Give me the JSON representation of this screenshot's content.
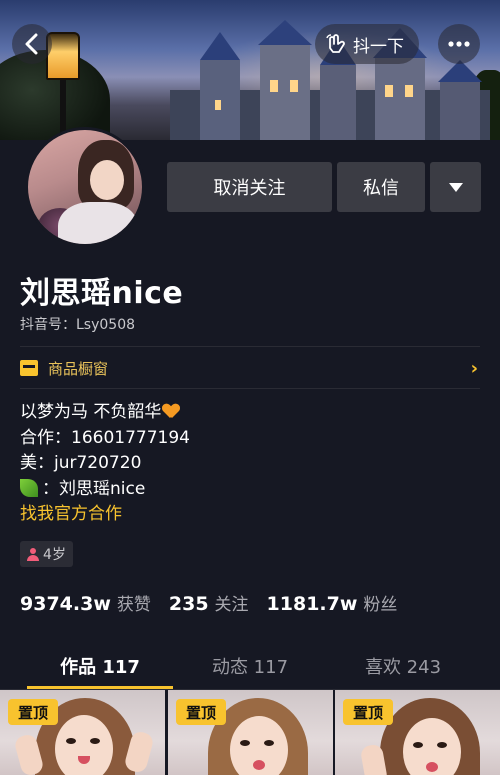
{
  "header": {
    "share_label": "抖一下",
    "back_icon": "chevron-left-icon",
    "share_icon": "shake-icon",
    "more_icon": "more-dots-icon"
  },
  "profile": {
    "name": "刘思瑶nice",
    "id_label": "抖音号：Lsy0508"
  },
  "actions": {
    "unfollow_label": "取消关注",
    "message_label": "私信",
    "dropdown_icon": "triangle-down-icon"
  },
  "shop": {
    "label": "商品橱窗",
    "icon": "storefront-icon",
    "arrow": "›"
  },
  "bio": {
    "line1": "以梦为马 不负韶华",
    "line2": "合作：16601777194",
    "line3": " 美：jur720720",
    "line4": "：刘思瑶nice",
    "line5": "找我官方合作"
  },
  "tags": {
    "age": "4岁"
  },
  "stats": [
    {
      "num": "9374.3w",
      "label": "获赞"
    },
    {
      "num": "235",
      "label": "关注"
    },
    {
      "num": "1181.7w",
      "label": "粉丝"
    }
  ],
  "tabs": [
    {
      "label": "作品 117"
    },
    {
      "label": "动态 117"
    },
    {
      "label": "喜欢 243"
    }
  ],
  "posts": [
    {
      "pin_label": "置顶"
    },
    {
      "pin_label": "置顶"
    },
    {
      "pin_label": "置顶"
    }
  ],
  "colors": {
    "background": "#161823",
    "accent": "#f8c32e",
    "button": "#3b3c44"
  }
}
